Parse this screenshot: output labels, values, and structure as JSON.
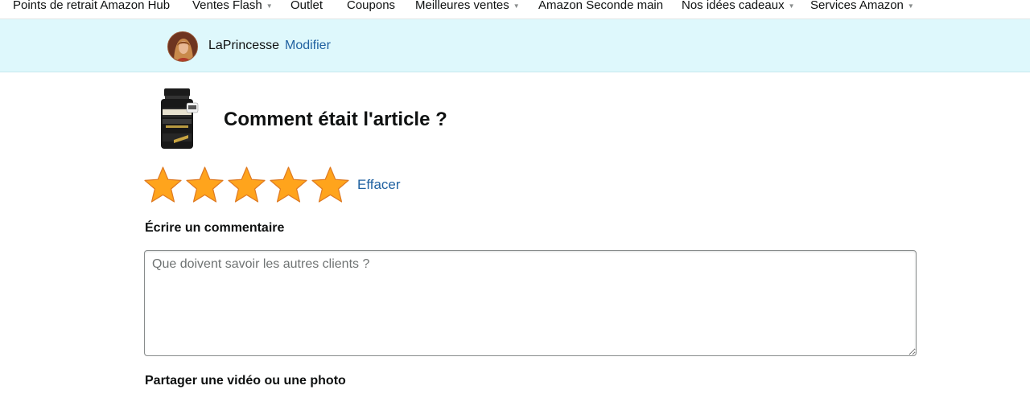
{
  "topnav": {
    "items": [
      {
        "label": "Points de retrait Amazon Hub",
        "has_caret": false
      },
      {
        "label": "Ventes Flash",
        "has_caret": true
      },
      {
        "label": "Outlet",
        "has_caret": false
      },
      {
        "label": "Coupons",
        "has_caret": false
      },
      {
        "label": "Meilleures ventes",
        "has_caret": true
      },
      {
        "label": "Amazon Seconde main",
        "has_caret": false
      },
      {
        "label": "Nos idées cadeaux",
        "has_caret": true
      },
      {
        "label": "Services Amazon",
        "has_caret": true
      }
    ]
  },
  "profile": {
    "name": "LaPrincesse",
    "edit_label": "Modifier"
  },
  "product": {
    "image_icon": "supplement-bottle-icon",
    "question": "Comment était l'article ?"
  },
  "rating": {
    "value": 5,
    "max": 5,
    "clear_label": "Effacer",
    "star_color": "#ffa41c",
    "star_outline": "#de7921"
  },
  "comment": {
    "label": "Écrire un commentaire",
    "placeholder": "Que doivent savoir les autres clients ?",
    "value": ""
  },
  "media": {
    "label": "Partager une vidéo ou une photo"
  },
  "colors": {
    "link": "#2162a1",
    "profile_band": "#def8fc"
  }
}
